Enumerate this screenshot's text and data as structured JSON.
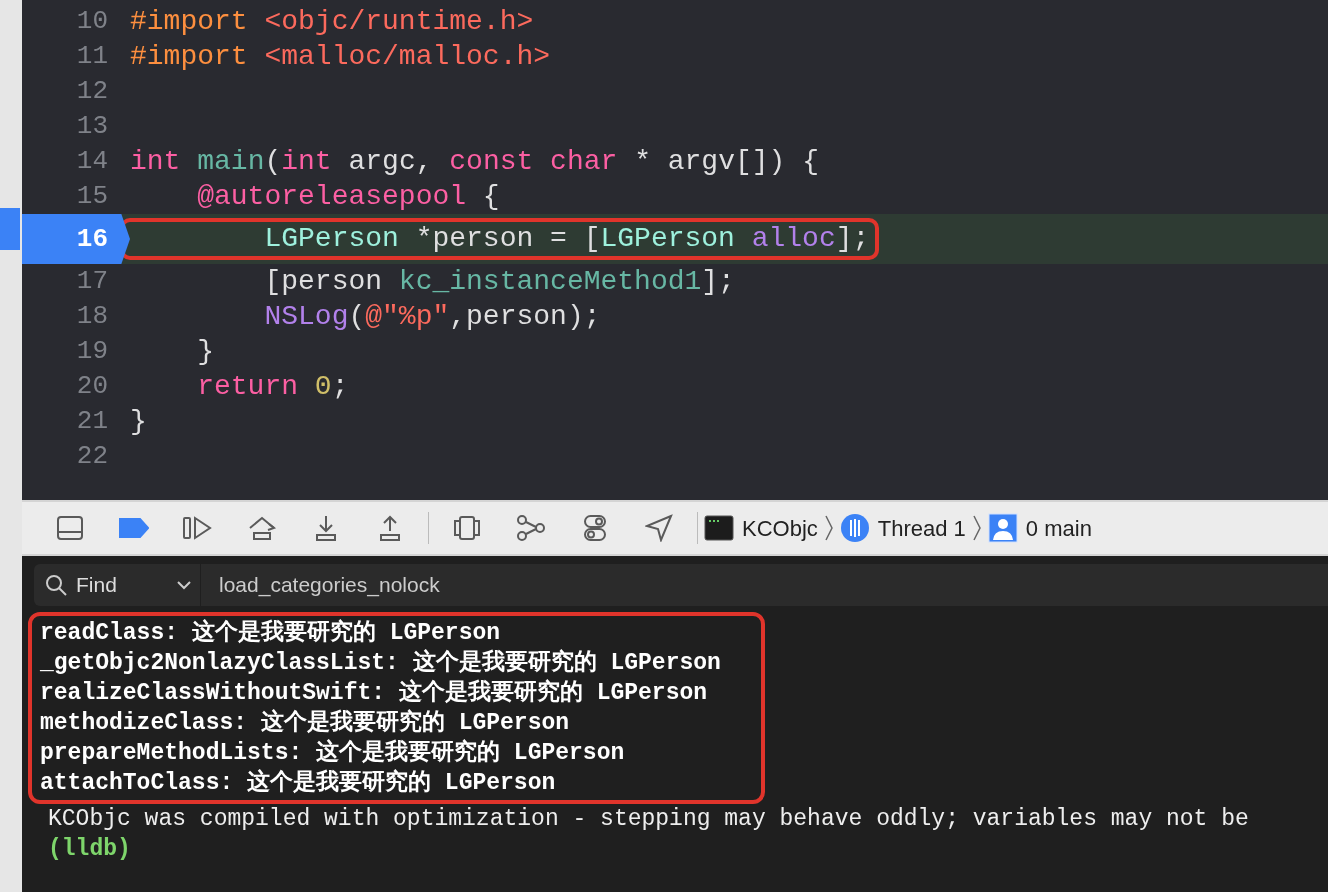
{
  "editor": {
    "lines": [
      {
        "number": "10",
        "current": false,
        "annotated": false,
        "tokens": [
          {
            "kind": "preprocessor",
            "text": "#import"
          },
          {
            "kind": "string",
            "text": " <objc/runtime.h>"
          }
        ]
      },
      {
        "number": "11",
        "current": false,
        "annotated": false,
        "tokens": [
          {
            "kind": "preprocessor",
            "text": "#import"
          },
          {
            "kind": "string",
            "text": " <malloc/malloc.h>"
          }
        ]
      },
      {
        "number": "12",
        "current": false,
        "annotated": false
      },
      {
        "number": "13",
        "current": false,
        "annotated": false
      },
      {
        "number": "14",
        "current": false,
        "annotated": false,
        "tokens": [
          {
            "kind": "keyword",
            "text": "int"
          },
          {
            "kind": "function",
            "text": " main"
          },
          {
            "kind": "plain",
            "text": "("
          },
          {
            "kind": "keyword",
            "text": "int"
          },
          {
            "kind": "plain",
            "text": " argc, "
          },
          {
            "kind": "keyword",
            "text": "const"
          },
          {
            "kind": "keyword",
            "text": " char"
          },
          {
            "kind": "plain",
            "text": " * argv[]) {"
          }
        ]
      },
      {
        "number": "15",
        "current": false,
        "annotated": false,
        "tokens": [
          {
            "kind": "keyword",
            "text": "    @autoreleasepool"
          },
          {
            "kind": "plain",
            "text": " {"
          }
        ]
      },
      {
        "number": "16",
        "current": true,
        "annotated": true,
        "tokens": [
          {
            "kind": "class",
            "text": "        LGPerson"
          },
          {
            "kind": "plain",
            "text": " *person = ["
          },
          {
            "kind": "class",
            "text": "LGPerson"
          },
          {
            "kind": "method",
            "text": " alloc"
          },
          {
            "kind": "plain",
            "text": "];"
          }
        ]
      },
      {
        "number": "17",
        "current": false,
        "annotated": false,
        "tokens": [
          {
            "kind": "plain",
            "text": "        [person"
          },
          {
            "kind": "function",
            "text": " kc_instanceMethod1"
          },
          {
            "kind": "plain",
            "text": "];"
          }
        ]
      },
      {
        "number": "18",
        "current": false,
        "annotated": false,
        "tokens": [
          {
            "kind": "method",
            "text": "        NSLog"
          },
          {
            "kind": "plain",
            "text": "("
          },
          {
            "kind": "string",
            "text": "@\"%p\""
          },
          {
            "kind": "plain",
            "text": ",person);"
          }
        ]
      },
      {
        "number": "19",
        "current": false,
        "annotated": false,
        "tokens": [
          {
            "kind": "plain",
            "text": "    }"
          }
        ]
      },
      {
        "number": "20",
        "current": false,
        "annotated": false,
        "tokens": [
          {
            "kind": "keyword",
            "text": "    return"
          },
          {
            "kind": "number",
            "text": " 0"
          },
          {
            "kind": "plain",
            "text": ";"
          }
        ]
      },
      {
        "number": "21",
        "current": false,
        "annotated": false,
        "tokens": [
          {
            "kind": "plain",
            "text": "}"
          }
        ]
      },
      {
        "number": "22",
        "current": false,
        "annotated": false
      }
    ]
  },
  "debug_bar": {
    "breakpoints_active": true,
    "breadcrumb": [
      {
        "kind": "target",
        "label": "KCObjc"
      },
      {
        "kind": "thread",
        "label": "Thread 1"
      },
      {
        "kind": "frame",
        "label": "0 main"
      }
    ]
  },
  "console": {
    "find": {
      "mode": "Find",
      "value": "load_categories_nolock"
    },
    "output": [
      {
        "kind": "log",
        "annotated": true,
        "text": "readClass: 这个是我要研究的 LGPerson"
      },
      {
        "kind": "log",
        "annotated": true,
        "text": "_getObjc2NonlazyClassList: 这个是我要研究的 LGPerson"
      },
      {
        "kind": "log",
        "annotated": true,
        "text": "realizeClassWithoutSwift: 这个是我要研究的 LGPerson"
      },
      {
        "kind": "log",
        "annotated": true,
        "text": "methodizeClass: 这个是我要研究的 LGPerson"
      },
      {
        "kind": "log",
        "annotated": true,
        "text": "prepareMethodLists: 这个是我要研究的 LGPerson"
      },
      {
        "kind": "log",
        "annotated": true,
        "text": "attachToClass: 这个是我要研究的 LGPerson"
      },
      {
        "kind": "message",
        "annotated": false,
        "text": "KCObjc was compiled with optimization - stepping may behave oddly; variables may not be"
      },
      {
        "kind": "prompt",
        "annotated": false,
        "text": "(lldb)"
      }
    ]
  }
}
